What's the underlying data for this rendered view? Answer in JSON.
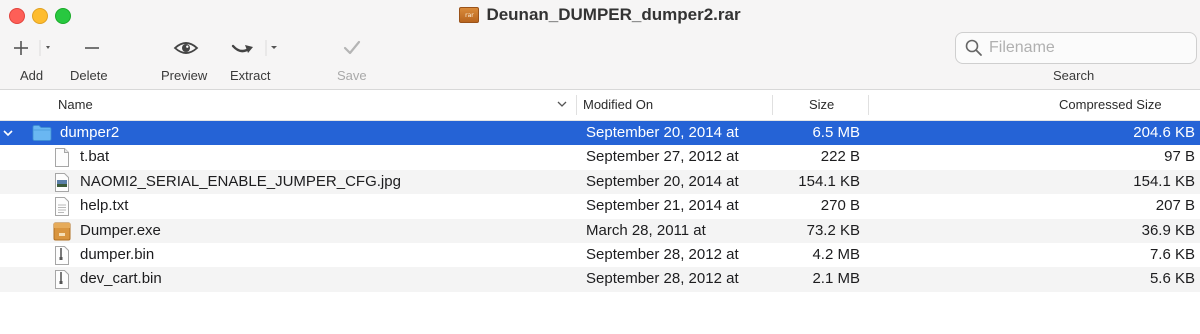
{
  "window": {
    "title": "Deunan_DUMPER_dumper2.rar",
    "title_icon_text": "rar"
  },
  "toolbar": {
    "add_label": "Add",
    "delete_label": "Delete",
    "preview_label": "Preview",
    "extract_label": "Extract",
    "save_label": "Save",
    "search_label": "Search",
    "search_placeholder": "Filename"
  },
  "columns": {
    "name": "Name",
    "modified": "Modified On",
    "size": "Size",
    "compressed": "Compressed Size"
  },
  "files": [
    {
      "name": "dumper2",
      "modified": "September 20, 2014 at",
      "size": "6.5 MB",
      "compressed": "204.6 KB",
      "icon": "folder-icon"
    },
    {
      "name": "t.bat",
      "modified": "September 27, 2012 at",
      "size": "222 B",
      "compressed": "97 B",
      "icon": "document-icon"
    },
    {
      "name": "NAOMI2_SERIAL_ENABLE_JUMPER_CFG.jpg",
      "modified": "September 20, 2014 at",
      "size": "154.1 KB",
      "compressed": "154.1 KB",
      "icon": "image-file-icon"
    },
    {
      "name": "help.txt",
      "modified": "September 21, 2014 at",
      "size": "270 B",
      "compressed": "207 B",
      "icon": "text-file-icon"
    },
    {
      "name": "Dumper.exe",
      "modified": "March 28, 2011 at",
      "size": "73.2 KB",
      "compressed": "36.9 KB",
      "icon": "executable-icon"
    },
    {
      "name": "dumper.bin",
      "modified": "September 28, 2012 at",
      "size": "4.2 MB",
      "compressed": "7.6 KB",
      "icon": "binary-file-icon"
    },
    {
      "name": "dev_cart.bin",
      "modified": "September 28, 2012 at",
      "size": "2.1 MB",
      "compressed": "5.6 KB",
      "icon": "binary-file-icon"
    }
  ],
  "colors": {
    "selection": "#2563d6",
    "folder": "#5aa9ea"
  }
}
